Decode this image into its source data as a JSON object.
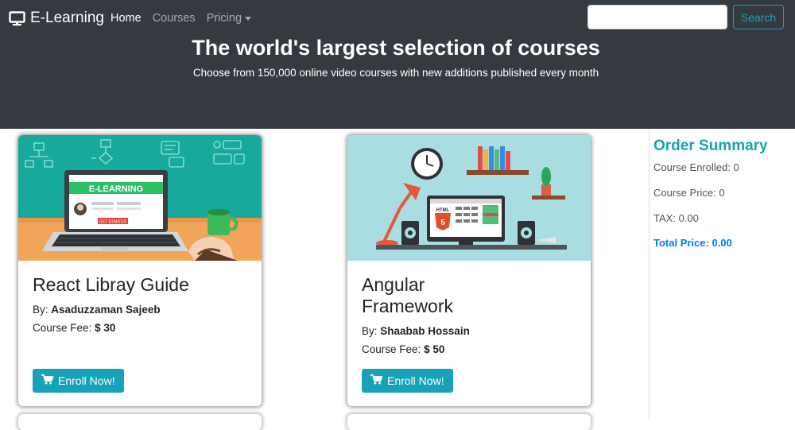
{
  "nav": {
    "brand": "E-Learning",
    "links": [
      {
        "label": "Home"
      },
      {
        "label": "Courses"
      },
      {
        "label": "Pricing"
      }
    ],
    "search_placeholder": "",
    "search_button": "Search"
  },
  "hero": {
    "title": "The world's largest selection of courses",
    "subtitle": "Choose from 150,000 online video courses with new additions published every month"
  },
  "courses": [
    {
      "title": "React Libray Guide",
      "by_label": "By:",
      "author": "Asaduzzaman Sajeeb",
      "fee_label": "Course Fee:",
      "fee": "$ 30",
      "button": "Enroll Now!",
      "image_text": "E-LEARNING",
      "image_button_text": "GET STARTED"
    },
    {
      "title": "Angular Framework",
      "by_label": "By:",
      "author": "Shaabab Hossain",
      "fee_label": "Course Fee:",
      "fee": "$ 50",
      "button": "Enroll Now!",
      "image_text": "HTML",
      "image_button_text": "5"
    }
  ],
  "summary": {
    "title": "Order Summary",
    "enrolled_label": "Course Enrolled:",
    "enrolled_value": "0",
    "price_label": "Course Price:",
    "price_value": "0",
    "tax_label": "TAX:",
    "tax_value": "0.00",
    "total_label": "Total Price:",
    "total_value": "0.00"
  },
  "icons": {
    "brand": "desktop-icon",
    "caret": "caret-down-icon",
    "cart": "shopping-cart-icon"
  },
  "colors": {
    "navbar": "#343a40",
    "accent": "#17a2b8",
    "total": "#007bff"
  }
}
